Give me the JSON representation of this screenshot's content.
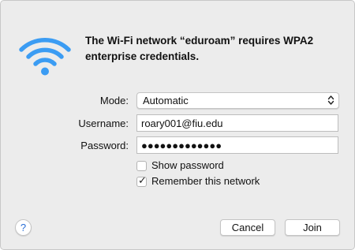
{
  "dialog": {
    "title": "The Wi-Fi network “eduroam” requires WPA2 enterprise credentials.",
    "icon": "wifi-icon",
    "accent_color": "#3b9cf3"
  },
  "form": {
    "mode_label": "Mode:",
    "mode_value": "Automatic",
    "username_label": "Username:",
    "username_value": "roary001@fiu.edu",
    "password_label": "Password:",
    "password_value": "●●●●●●●●●●●●●"
  },
  "options": {
    "show_password_label": "Show password",
    "show_password_checked": false,
    "remember_label": "Remember this network",
    "remember_checked": true,
    "check_glyph": "✓"
  },
  "buttons": {
    "help_label": "?",
    "cancel_label": "Cancel",
    "join_label": "Join"
  }
}
